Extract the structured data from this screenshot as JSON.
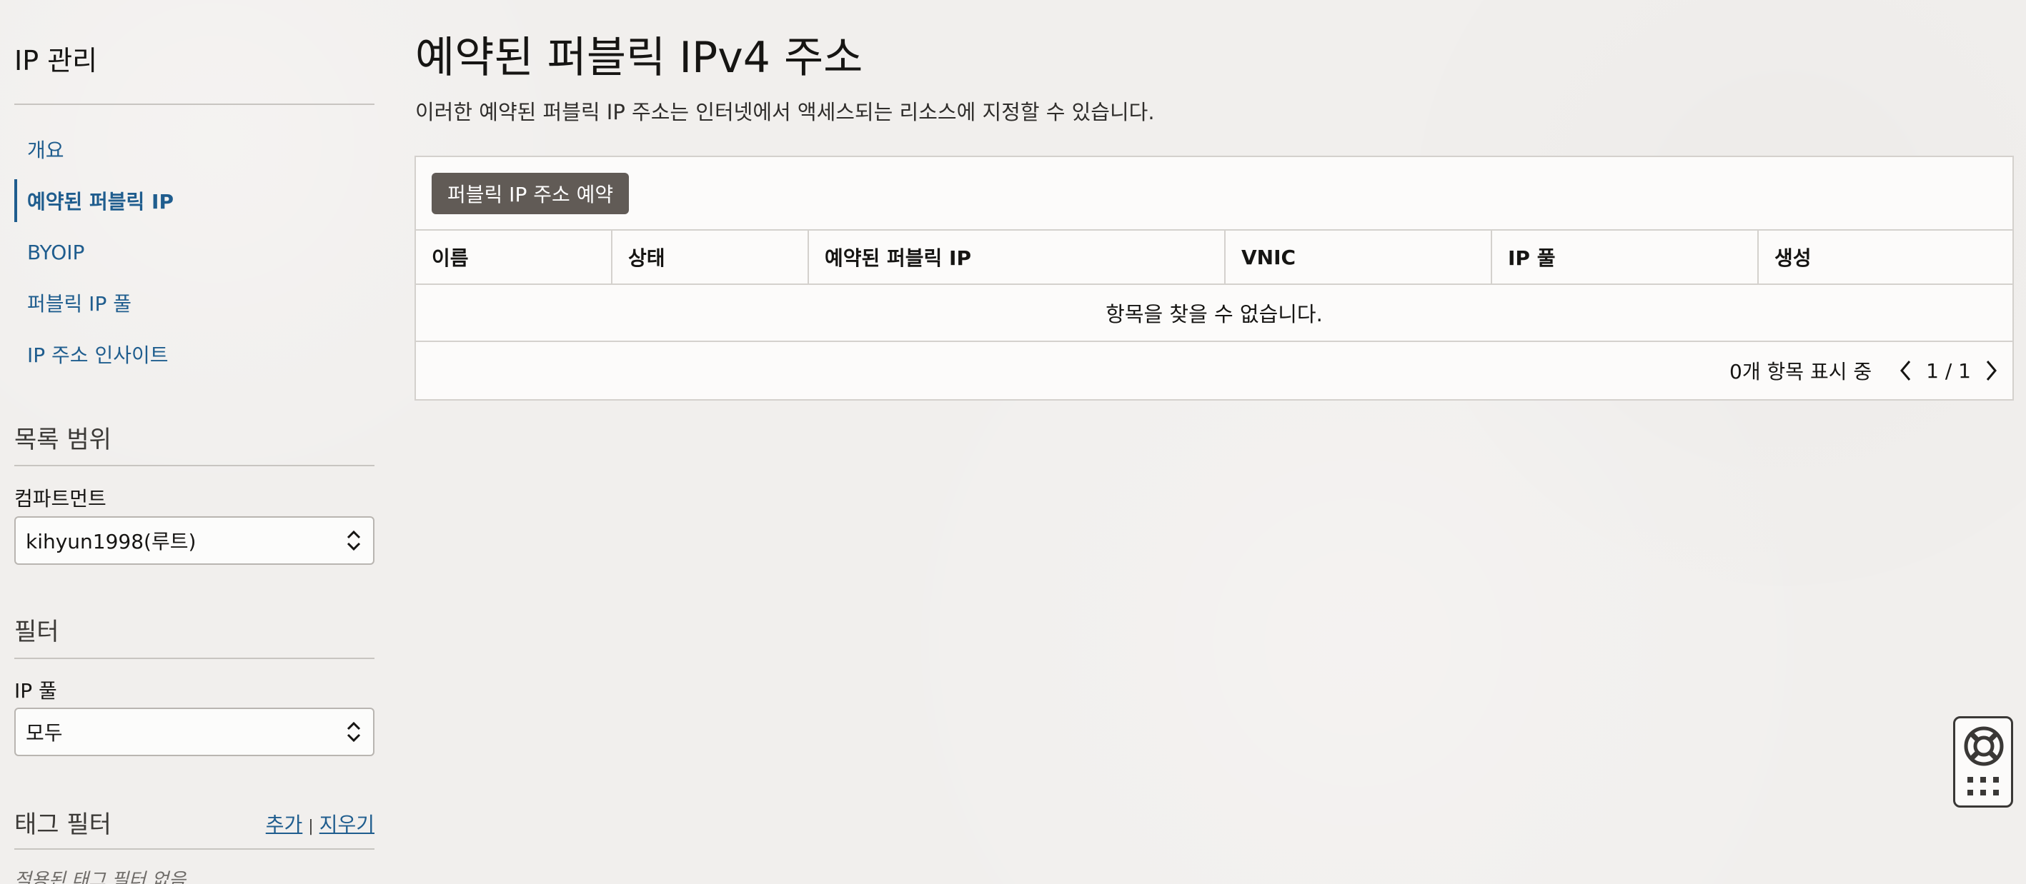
{
  "sidebar": {
    "title": "IP 관리",
    "nav": [
      {
        "label": "개요"
      },
      {
        "label": "예약된 퍼블릭 IP"
      },
      {
        "label": "BYOIP"
      },
      {
        "label": "퍼블릭 IP 풀"
      },
      {
        "label": "IP 주소 인사이트"
      }
    ],
    "scope": {
      "title": "목록 범위",
      "compartment_label": "컴파트먼트",
      "compartment_value": "kihyun1998(루트)"
    },
    "filters": {
      "title": "필터",
      "ip_pool_label": "IP 풀",
      "ip_pool_value": "모두"
    },
    "tag_filters": {
      "title": "태그 필터",
      "add": "추가",
      "separator": "|",
      "clear": "지우기",
      "empty": "적용된 태그 필터 없음"
    }
  },
  "main": {
    "title": "예약된 퍼블릭 IPv4 주소",
    "description": "이러한 예약된 퍼블릭 IP 주소는 인터넷에서 액세스되는 리소스에 지정할 수 있습니다.",
    "reserve_button": "퍼블릭 IP 주소 예약",
    "columns": [
      "이름",
      "상태",
      "예약된 퍼블릭 IP",
      "VNIC",
      "IP 풀",
      "생성"
    ],
    "empty_message": "항목을 찾을 수 없습니다.",
    "pager": {
      "count": "0개 항목 표시 중",
      "page": "1 / 1"
    }
  },
  "colors": {
    "accent": "#1f5d8e",
    "button": "#615b56",
    "background": "#f1efed"
  },
  "icons": [
    "select-chevrons-icon",
    "chevron-left-icon",
    "chevron-right-icon",
    "lifebuoy-icon",
    "apps-grid-icon"
  ]
}
